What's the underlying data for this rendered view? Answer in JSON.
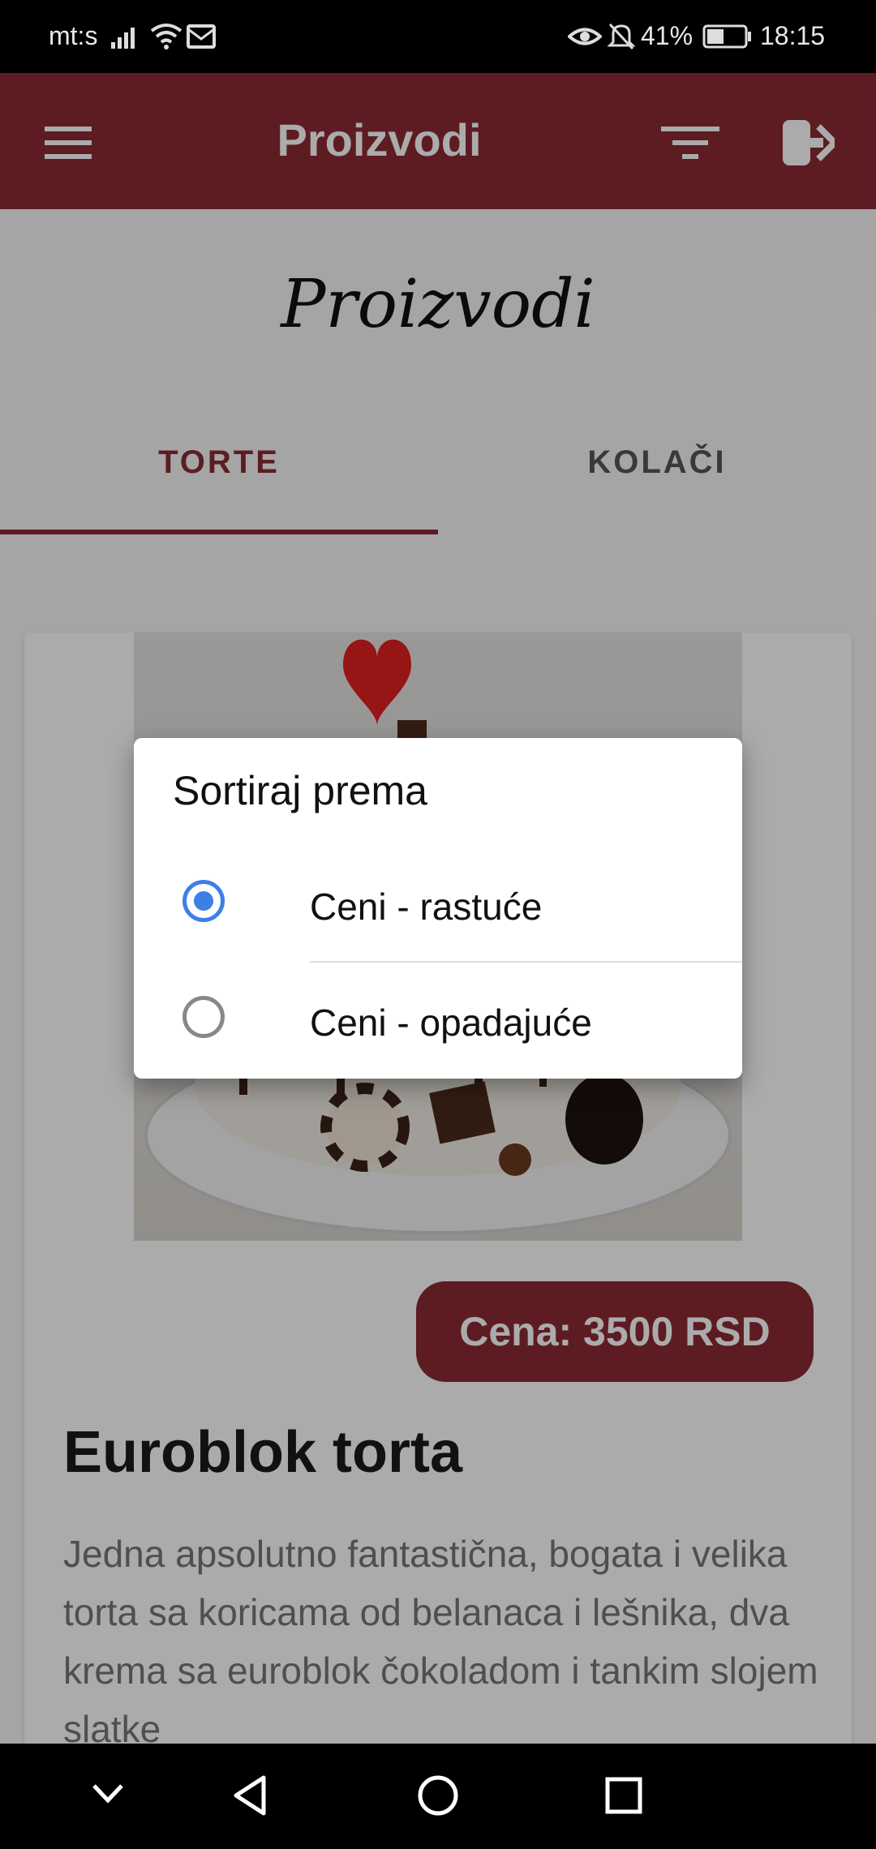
{
  "status_bar": {
    "carrier": "mt:s",
    "battery": "41%",
    "time": "18:15"
  },
  "app_bar": {
    "title": "Proizvodi",
    "icons": [
      "menu-icon",
      "filter-icon",
      "logout-icon"
    ]
  },
  "page": {
    "heading": "Proizvodi",
    "tabs": [
      {
        "label": "TORTE",
        "selected": true
      },
      {
        "label": "KOLAČI",
        "selected": false
      }
    ]
  },
  "product": {
    "price": "Cena: 3500 RSD",
    "title": "Euroblok torta",
    "description": "Jedna apsolutno fantastična, bogata i velika torta sa koricama od belanaca i lešnika, dva krema sa euroblok čokoladom i tankim slojem slatke"
  },
  "sort_dialog": {
    "title": "Sortiraj prema",
    "options": [
      {
        "label": "Ceni - rastuće",
        "selected": true
      },
      {
        "label": "Ceni - opadajuće",
        "selected": false
      }
    ]
  },
  "colors": {
    "brand": "#8b2a33",
    "radio_accent": "#3d7fe5"
  }
}
